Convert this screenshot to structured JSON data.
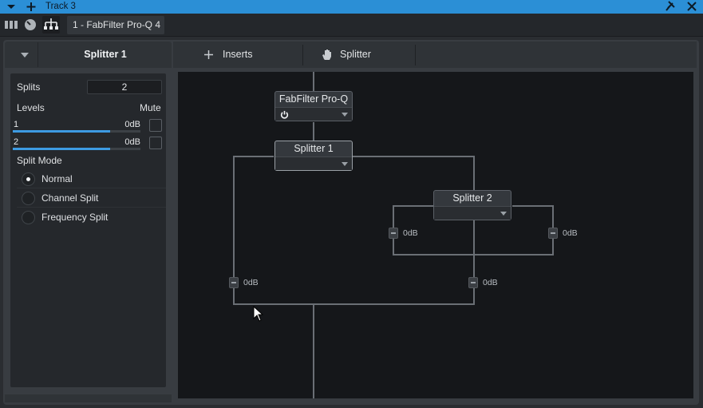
{
  "titlebar": {
    "title": "Track 3"
  },
  "toolbar": {
    "plugin_tab": "1 - FabFilter Pro-Q 4"
  },
  "left_panel": {
    "title": "Splitter 1",
    "splits_label": "Splits",
    "splits_value": "2",
    "levels_label": "Levels",
    "mute_label": "Mute",
    "levels": [
      {
        "label": "1",
        "value": "0dB",
        "fill": 0.76
      },
      {
        "label": "2",
        "value": "0dB",
        "fill": 0.76
      }
    ],
    "split_mode_label": "Split Mode",
    "split_modes": [
      {
        "label": "Normal",
        "selected": true
      },
      {
        "label": "Channel Split",
        "selected": false
      },
      {
        "label": "Frequency Split",
        "selected": false
      }
    ]
  },
  "tabs": {
    "inserts": "Inserts",
    "splitter": "Splitter"
  },
  "graph": {
    "plugin_node": "FabFilter Pro-Q 4",
    "splitter1_node": "Splitter 1",
    "splitter2_node": "Splitter 2",
    "gains": [
      "0dB",
      "0dB",
      "0dB",
      "0dB"
    ]
  }
}
